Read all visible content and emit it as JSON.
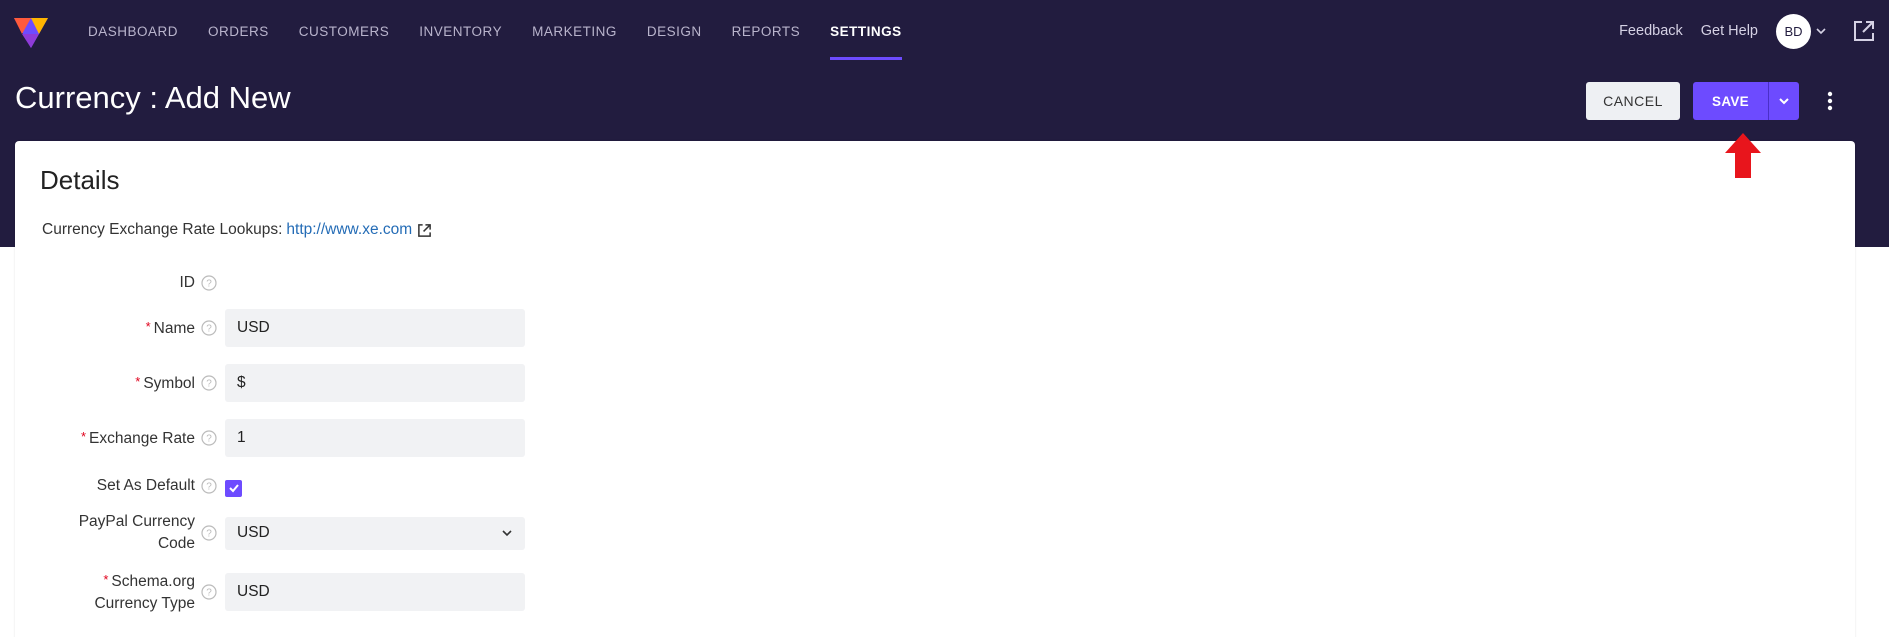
{
  "nav": {
    "items": [
      {
        "label": "DASHBOARD"
      },
      {
        "label": "ORDERS"
      },
      {
        "label": "CUSTOMERS"
      },
      {
        "label": "INVENTORY"
      },
      {
        "label": "MARKETING"
      },
      {
        "label": "DESIGN"
      },
      {
        "label": "REPORTS"
      },
      {
        "label": "SETTINGS",
        "active": true
      }
    ],
    "feedback": "Feedback",
    "get_help": "Get Help",
    "avatar_initials": "BD"
  },
  "page": {
    "title": "Currency : Add New",
    "cancel_label": "CANCEL",
    "save_label": "SAVE"
  },
  "card": {
    "title": "Details",
    "lookup_label": "Currency Exchange Rate Lookups:",
    "lookup_link": "http://www.xe.com"
  },
  "form": {
    "id_label": "ID",
    "name_label": "Name",
    "name_value": "USD",
    "symbol_label": "Symbol",
    "symbol_value": "$",
    "rate_label": "Exchange Rate",
    "rate_value": "1",
    "default_label": "Set As Default",
    "default_checked": true,
    "paypal_label_line1": "PayPal Currency",
    "paypal_label_line2": "Code",
    "paypal_value": "USD",
    "schema_label_line1": "Schema.org",
    "schema_label_line2": "Currency Type",
    "schema_value": "USD"
  },
  "colors": {
    "header_bg": "#221c3f",
    "accent": "#6d4bff",
    "required": "#e0001b",
    "link": "#246cb6",
    "annotation_arrow": "#e8151c"
  }
}
